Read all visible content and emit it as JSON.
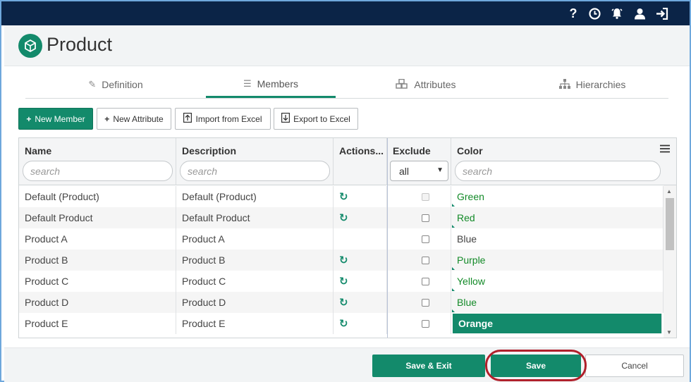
{
  "topbar": {
    "icons": [
      "help-icon",
      "clock-icon",
      "bell-icon",
      "user-icon",
      "logout-icon"
    ],
    "help_glyph": "?"
  },
  "page": {
    "title": "Product"
  },
  "tabs": [
    {
      "label": "Definition",
      "icon": "pencil-icon"
    },
    {
      "label": "Members",
      "icon": "list-icon",
      "active": true
    },
    {
      "label": "Attributes",
      "icon": "cubes-icon"
    },
    {
      "label": "Hierarchies",
      "icon": "sitemap-icon"
    }
  ],
  "toolbar": {
    "new_member": "New Member",
    "new_attribute": "New Attribute",
    "import_excel": "Import from Excel",
    "export_excel": "Export to Excel"
  },
  "grid": {
    "columns": {
      "name": "Name",
      "description": "Description",
      "actions": "Actions...",
      "exclude": "Exclude",
      "color": "Color"
    },
    "search_placeholder": "search",
    "exclude_filter": "all",
    "rows": [
      {
        "name": "Default (Product)",
        "description": "Default (Product)",
        "action": true,
        "exclude_disabled": true,
        "color": "Green",
        "color_modified": true
      },
      {
        "name": "Default Product",
        "description": "Default Product",
        "action": true,
        "exclude_disabled": false,
        "color": "Red",
        "color_modified": true
      },
      {
        "name": "Product A",
        "description": "Product A",
        "action": false,
        "exclude_disabled": false,
        "color": "Blue",
        "color_modified": false
      },
      {
        "name": "Product B",
        "description": "Product B",
        "action": true,
        "exclude_disabled": false,
        "color": "Purple",
        "color_modified": true
      },
      {
        "name": "Product C",
        "description": "Product C",
        "action": true,
        "exclude_disabled": false,
        "color": "Yellow",
        "color_modified": true
      },
      {
        "name": "Product D",
        "description": "Product D",
        "action": true,
        "exclude_disabled": false,
        "color": "Blue",
        "color_modified": true
      },
      {
        "name": "Product E",
        "description": "Product E",
        "action": true,
        "exclude_disabled": false,
        "color": "Orange",
        "color_modified": true,
        "selected": true
      }
    ]
  },
  "footer": {
    "save_exit": "Save & Exit",
    "save": "Save",
    "cancel": "Cancel"
  },
  "colors": {
    "accent": "#138a6b",
    "topbar": "#0b2447",
    "highlight_ring": "#b0202b"
  }
}
